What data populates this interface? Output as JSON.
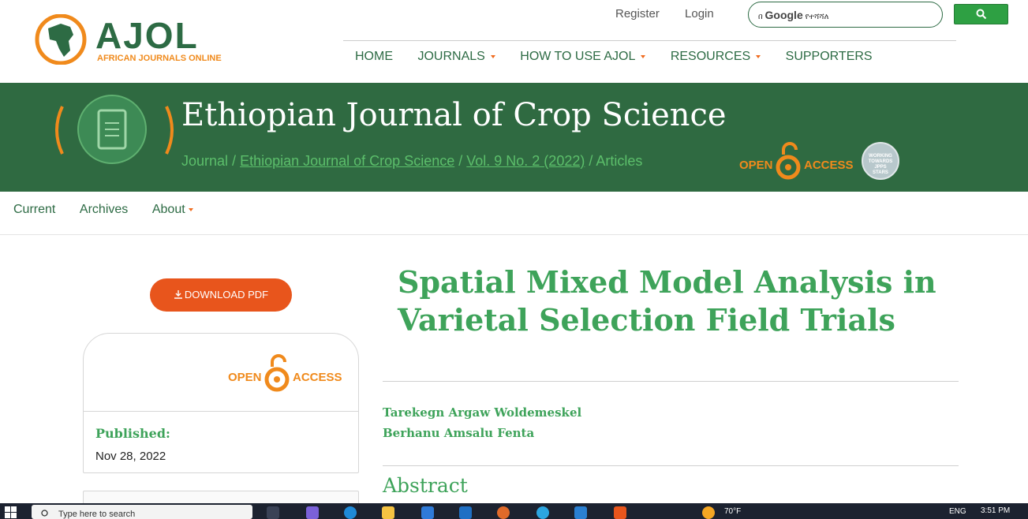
{
  "header": {
    "logo_name": "AJOL",
    "logo_subtitle": "AFRICAN JOURNALS ONLINE",
    "register": "Register",
    "login": "Login",
    "search_prefix": "በ",
    "search_brand": "Google",
    "search_value": "የተሻሻለ"
  },
  "nav": {
    "home": "HOME",
    "journals": "JOURNALS",
    "how_to": "HOW TO USE AJOL",
    "resources": "RESOURCES",
    "supporters": "SUPPORTERS"
  },
  "banner": {
    "title": "Ethiopian Journal of Crop Science",
    "crumb_journal": "Journal",
    "crumb_sep": " / ",
    "crumb_ejcs": "Ethiopian Journal of Crop Science",
    "crumb_issue": "Vol. 9 No. 2 (2022)",
    "crumb_articles": "Articles",
    "oa_open": "OPEN",
    "oa_access": "ACCESS",
    "jpps_line1": "WORKING",
    "jpps_line2": "TOWARDS",
    "jpps_line3": "JPPS",
    "jpps_line4": "STARS"
  },
  "subnav": {
    "current": "Current",
    "archives": "Archives",
    "about": "About"
  },
  "sidebar": {
    "download": "DOWNLOAD PDF",
    "oa_open": "OPEN",
    "oa_access": "ACCESS",
    "published_label": "Published:",
    "published_date": "Nov 28, 2022"
  },
  "article": {
    "title": "Spatial Mixed Model Analysis in Varietal Selection Field Trials",
    "authors": [
      "Tarekegn Argaw Woldemeskel",
      "Berhanu Amsalu Fenta"
    ],
    "abstract_heading": "Abstract"
  },
  "taskbar": {
    "search_placeholder": "Type here to search",
    "weather": "70°F",
    "lang": "ENG",
    "time": "3:51 PM"
  },
  "colors": {
    "brand_green": "#2f6a41",
    "accent_green": "#3ea35a",
    "orange": "#e8551c"
  }
}
